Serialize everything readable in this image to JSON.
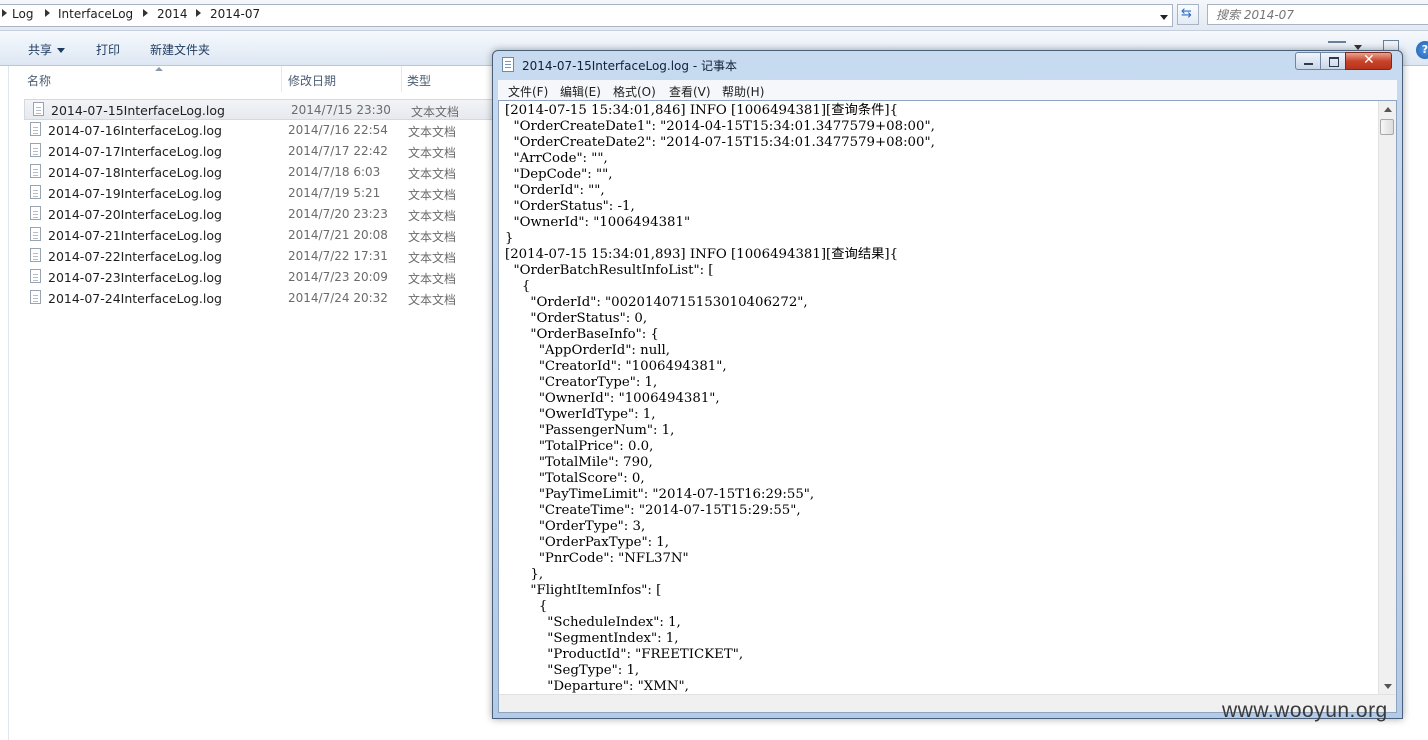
{
  "explorer": {
    "breadcrumb": [
      "Log",
      "InterfaceLog",
      "2014",
      "2014-07"
    ],
    "search_placeholder": "搜索 2014-07",
    "toolbar": {
      "share": "共享",
      "print": "打印",
      "new_folder": "新建文件夹"
    },
    "columns": {
      "name": "名称",
      "modified": "修改日期",
      "type": "类型"
    },
    "files": [
      {
        "name": "2014-07-15InterfaceLog.log",
        "date": "2014/7/15 23:30",
        "type": "文本文档"
      },
      {
        "name": "2014-07-16InterfaceLog.log",
        "date": "2014/7/16 22:54",
        "type": "文本文档"
      },
      {
        "name": "2014-07-17InterfaceLog.log",
        "date": "2014/7/17 22:42",
        "type": "文本文档"
      },
      {
        "name": "2014-07-18InterfaceLog.log",
        "date": "2014/7/18 6:03",
        "type": "文本文档"
      },
      {
        "name": "2014-07-19InterfaceLog.log",
        "date": "2014/7/19 5:21",
        "type": "文本文档"
      },
      {
        "name": "2014-07-20InterfaceLog.log",
        "date": "2014/7/20 23:23",
        "type": "文本文档"
      },
      {
        "name": "2014-07-21InterfaceLog.log",
        "date": "2014/7/21 20:08",
        "type": "文本文档"
      },
      {
        "name": "2014-07-22InterfaceLog.log",
        "date": "2014/7/22 17:31",
        "type": "文本文档"
      },
      {
        "name": "2014-07-23InterfaceLog.log",
        "date": "2014/7/23 20:09",
        "type": "文本文档"
      },
      {
        "name": "2014-07-24InterfaceLog.log",
        "date": "2014/7/24 20:32",
        "type": "文本文档"
      }
    ]
  },
  "notepad": {
    "title": "2014-07-15InterfaceLog.log - 记事本",
    "menu": [
      "文件(F)",
      "编辑(E)",
      "格式(O)",
      "查看(V)",
      "帮助(H)"
    ],
    "content": "[2014-07-15 15:34:01,846] INFO [1006494381][查询条件]{\n  \"OrderCreateDate1\": \"2014-04-15T15:34:01.3477579+08:00\",\n  \"OrderCreateDate2\": \"2014-07-15T15:34:01.3477579+08:00\",\n  \"ArrCode\": \"\",\n  \"DepCode\": \"\",\n  \"OrderId\": \"\",\n  \"OrderStatus\": -1,\n  \"OwnerId\": \"1006494381\"\n}\n[2014-07-15 15:34:01,893] INFO [1006494381][查询结果]{\n  \"OrderBatchResultInfoList\": [\n    {\n      \"OrderId\": \"0020140715153010406272\",\n      \"OrderStatus\": 0,\n      \"OrderBaseInfo\": {\n        \"AppOrderId\": null,\n        \"CreatorId\": \"1006494381\",\n        \"CreatorType\": 1,\n        \"OwnerId\": \"1006494381\",\n        \"OwerIdType\": 1,\n        \"PassengerNum\": 1,\n        \"TotalPrice\": 0.0,\n        \"TotalMile\": 790,\n        \"TotalScore\": 0,\n        \"PayTimeLimit\": \"2014-07-15T16:29:55\",\n        \"CreateTime\": \"2014-07-15T15:29:55\",\n        \"OrderType\": 3,\n        \"OrderPaxType\": 1,\n        \"PnrCode\": \"NFL37N\"\n      },\n      \"FlightItemInfos\": [\n        {\n          \"ScheduleIndex\": 1,\n          \"SegmentIndex\": 1,\n          \"ProductId\": \"FREETICKET\",\n          \"SegType\": 1,\n          \"Departure\": \"XMN\","
  },
  "watermark": "www.wooyun.org"
}
